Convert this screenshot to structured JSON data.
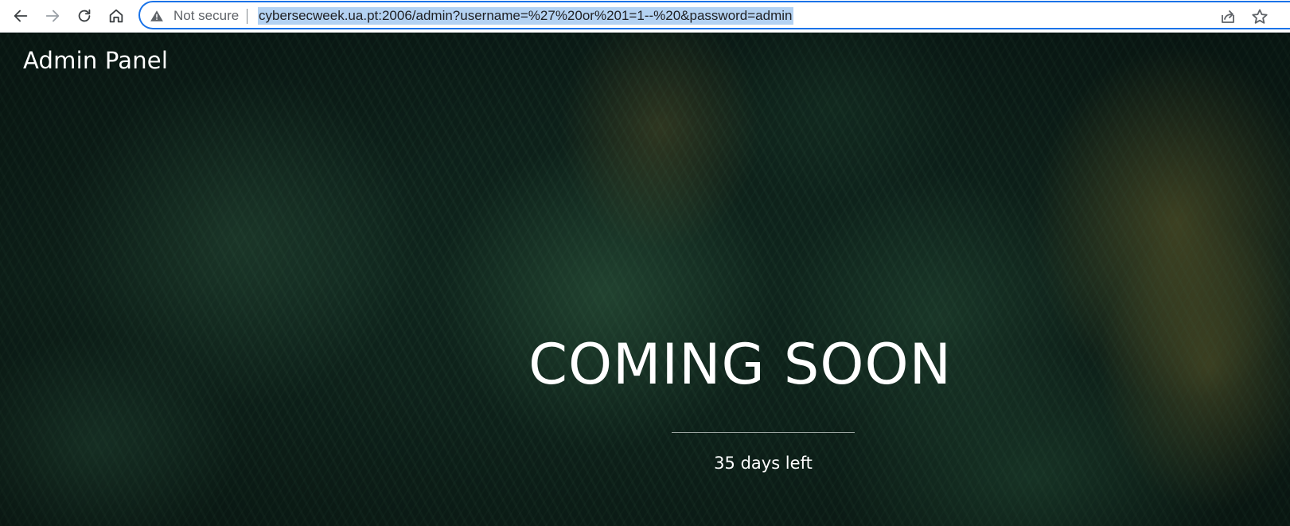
{
  "browser": {
    "back_icon": "arrow-left-icon",
    "forward_icon": "arrow-right-icon",
    "reload_icon": "reload-icon",
    "home_icon": "home-icon",
    "security_label": "Not secure",
    "security_icon": "warning-triangle-icon",
    "url": "cybersecweek.ua.pt:2006/admin?username=%27%20or%201=1--%20&password=admin",
    "share_icon": "share-icon",
    "bookmark_icon": "star-icon",
    "accent_color": "#1a73e8",
    "selection_color": "#b4d2f2"
  },
  "page": {
    "brand": "Admin Panel",
    "headline": "COMING SOON",
    "countdown": "35 days left"
  }
}
